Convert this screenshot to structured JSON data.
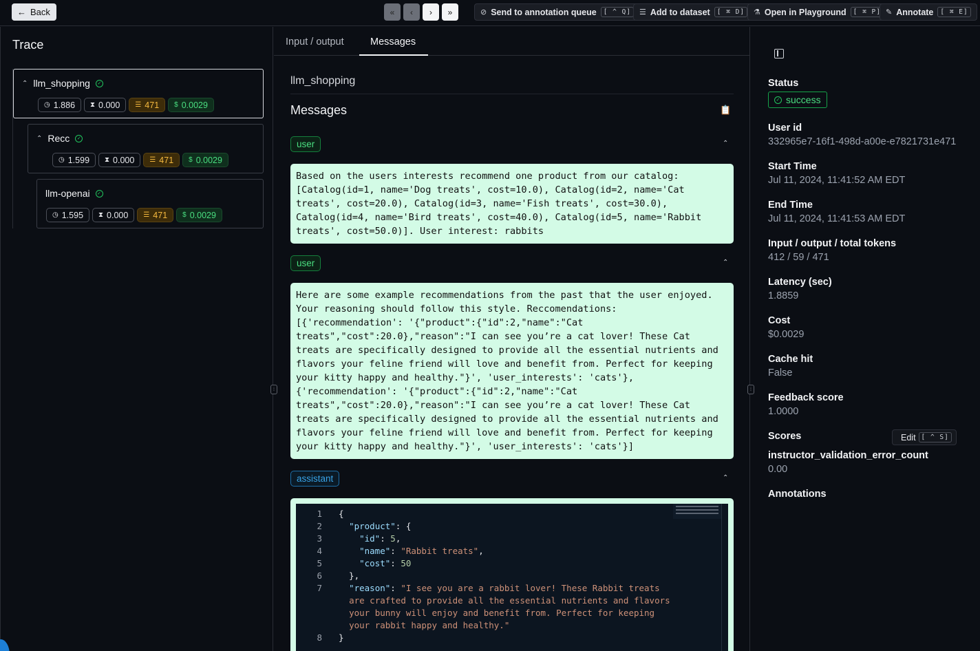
{
  "topbar": {
    "back_label": "Back",
    "actions": [
      {
        "label": "Send to annotation queue",
        "shortcut": "[ ^ Q]"
      },
      {
        "label": "Add to dataset",
        "shortcut": "[ ⌘ D]"
      },
      {
        "label": "Open in Playground",
        "shortcut": "[ ⌘ P]"
      },
      {
        "label": "Annotate",
        "shortcut": "[ ⌘ E]"
      }
    ]
  },
  "trace": {
    "title": "Trace",
    "nodes": [
      {
        "name": "llm_shopping",
        "latency": "1.886",
        "wait": "0.000",
        "tokens": "471",
        "cost": "0.0029"
      },
      {
        "name": "Recc",
        "latency": "1.599",
        "wait": "0.000",
        "tokens": "471",
        "cost": "0.0029"
      },
      {
        "name": "llm-openai",
        "latency": "1.595",
        "wait": "0.000",
        "tokens": "471",
        "cost": "0.0029"
      }
    ]
  },
  "main": {
    "tabs": [
      "Input / output",
      "Messages"
    ],
    "active_tab": "Messages",
    "run_name": "llm_shopping",
    "messages_title": "Messages",
    "messages": [
      {
        "role": "user",
        "content": "Based on the users interests recommend one product from our catalog: [Catalog(id=1, name='Dog treats', cost=10.0), Catalog(id=2, name='Cat treats', cost=20.0), Catalog(id=3, name='Fish treats', cost=30.0), Catalog(id=4, name='Bird treats', cost=40.0), Catalog(id=5, name='Rabbit treats', cost=50.0)]. User interest: rabbits"
      },
      {
        "role": "user",
        "content": "Here are some example recommendations from the past that the user enjoyed. Your reasoning should follow this style. Reccomendations: [{'recommendation': '{\"product\":{\"id\":2,\"name\":\"Cat treats\",\"cost\":20.0},\"reason\":\"I can see you’re a cat lover! These Cat treats are specifically designed to provide all the essential nutrients and flavors your feline friend will love and benefit from. Perfect for keeping your kitty happy and healthy.\"}', 'user_interests': 'cats'}, {'recommendation': '{\"product\":{\"id\":2,\"name\":\"Cat treats\",\"cost\":20.0},\"reason\":\"I can see you’re a cat lover! These Cat treats are specifically designed to provide all the essential nutrients and flavors your feline friend will love and benefit from. Perfect for keeping your kitty happy and healthy.\"}', 'user_interests': 'cats'}]"
      },
      {
        "role": "assistant"
      }
    ],
    "code": {
      "line_numbers": [
        "1",
        "2",
        "3",
        "4",
        "5",
        "6",
        "7",
        "",
        "",
        "",
        "8"
      ],
      "product_key": "\"product\"",
      "id_key": "\"id\"",
      "id_val": "5",
      "name_key": "\"name\"",
      "name_val": "\"Rabbit treats\"",
      "cost_key": "\"cost\"",
      "cost_val": "50",
      "reason_key": "\"reason\"",
      "reason_lines": [
        "\"I see you are a rabbit lover! These Rabbit treats",
        "are crafted to provide all the essential nutrients and flavors",
        "your bunny will enjoy and benefit from. Perfect for keeping",
        "your rabbit happy and healthy.\""
      ]
    }
  },
  "details": {
    "status_label": "Status",
    "status": "success",
    "user_id_label": "User id",
    "user_id": "332965e7-16f1-498d-a00e-e7821731e471",
    "start_label": "Start Time",
    "start": "Jul 11, 2024, 11:41:52 AM EDT",
    "end_label": "End Time",
    "end": "Jul 11, 2024, 11:41:53 AM EDT",
    "tokens_label": "Input / output / total tokens",
    "tokens": "412 / 59 / 471",
    "latency_label": "Latency (sec)",
    "latency": "1.8859",
    "cost_label": "Cost",
    "cost": "$0.0029",
    "cache_label": "Cache hit",
    "cache": "False",
    "feedback_label": "Feedback score",
    "feedback": "1.0000",
    "scores_label": "Scores",
    "edit_label": "Edit",
    "edit_shortcut": "[ ^ S]",
    "score_name": "instructor_validation_error_count",
    "score_value": "0.00",
    "annotations_label": "Annotations"
  },
  "colors": {
    "accent_green": "#4ade80",
    "token_amber": "#f5b93f",
    "message_bg": "#d3fbe6",
    "assistant_blue": "#38a2e6"
  }
}
